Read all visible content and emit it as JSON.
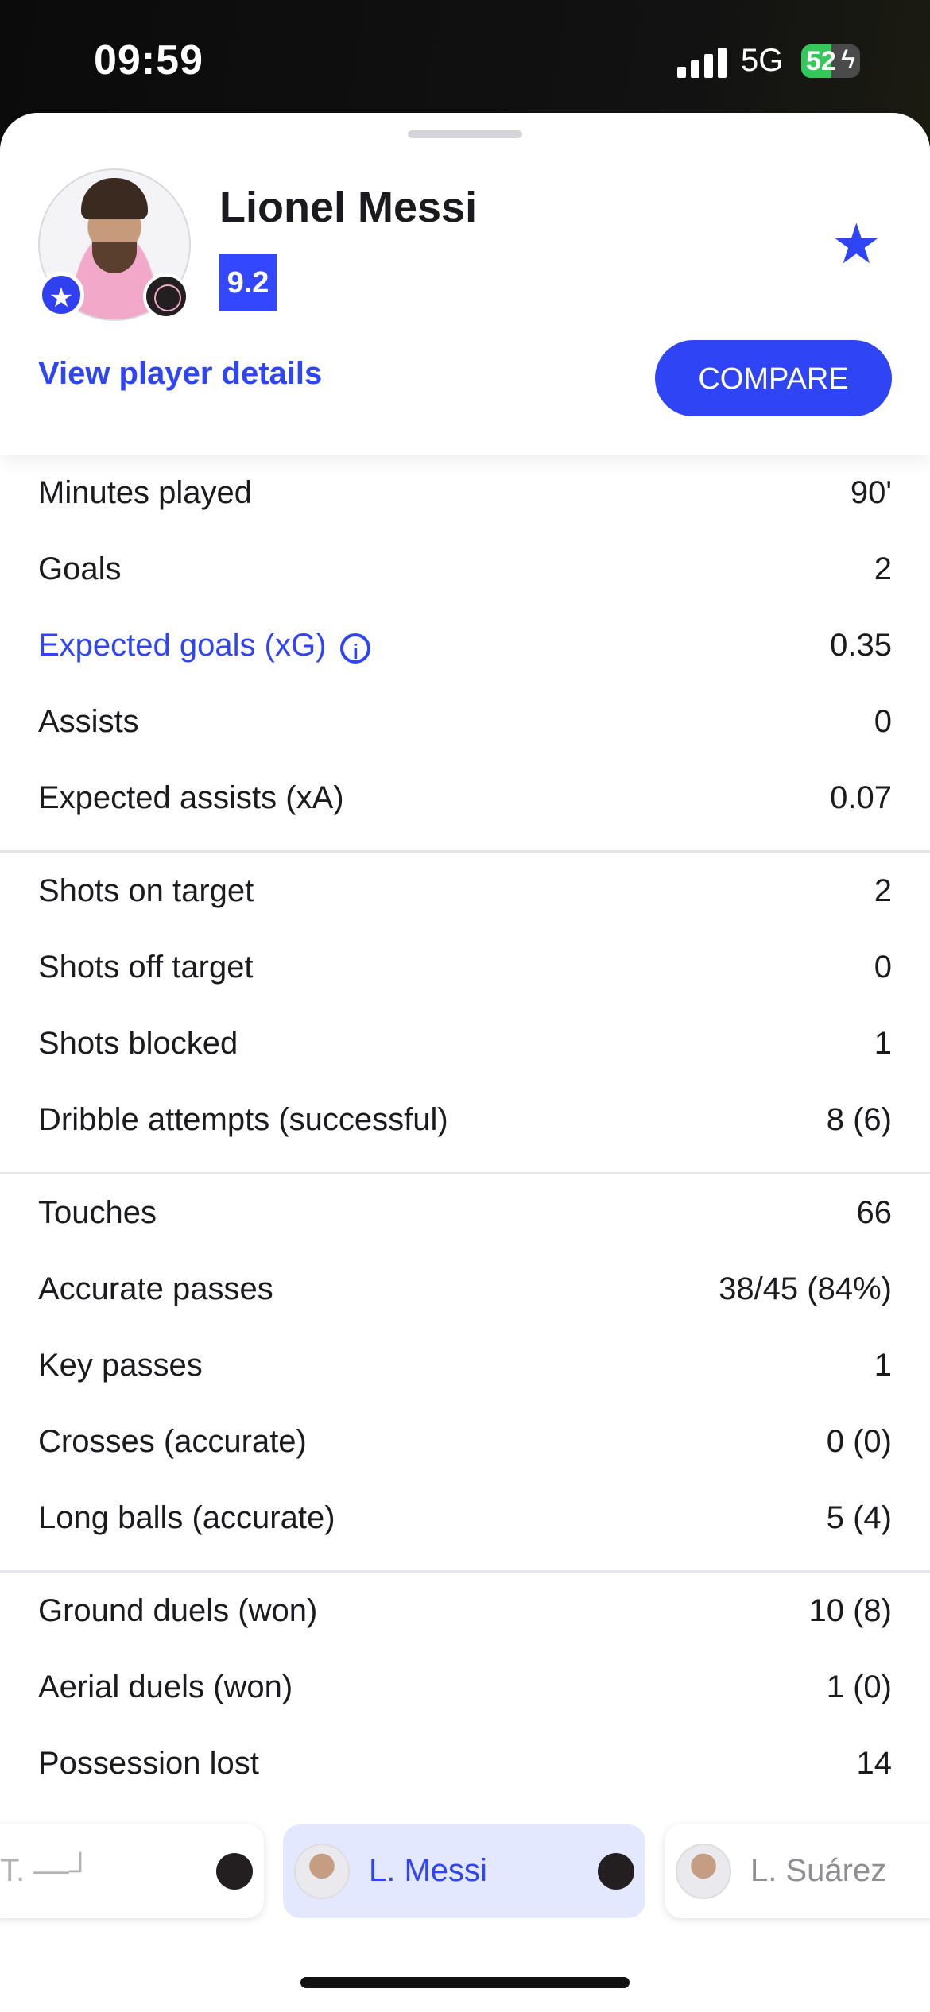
{
  "status_bar": {
    "time": "09:59",
    "network": "5G",
    "battery": "52",
    "battery_level": 0.52
  },
  "player": {
    "name": "Lionel Messi",
    "rating": "9.2",
    "view_details_label": "View player details",
    "compare_label": "COMPARE"
  },
  "stat_groups": [
    {
      "rows": [
        {
          "label": "Minutes played",
          "value": "90'"
        },
        {
          "label": "Goals",
          "value": "2"
        },
        {
          "label": "Expected goals (xG)",
          "value": "0.35"
        },
        {
          "label": "Assists",
          "value": "0"
        },
        {
          "label": "Expected assists (xA)",
          "value": "0.07"
        }
      ]
    },
    {
      "rows": [
        {
          "label": "Shots on target",
          "value": "2"
        },
        {
          "label": "Shots off target",
          "value": "0"
        },
        {
          "label": "Shots blocked",
          "value": "1"
        },
        {
          "label": "Dribble attempts (successful)",
          "value": "8 (6)"
        }
      ]
    },
    {
      "rows": [
        {
          "label": "Touches",
          "value": "66"
        },
        {
          "label": "Accurate passes",
          "value": "38/45 (84%)"
        },
        {
          "label": "Key passes",
          "value": "1"
        },
        {
          "label": "Crosses (accurate)",
          "value": "0 (0)"
        },
        {
          "label": "Long balls (accurate)",
          "value": "5 (4)"
        }
      ]
    },
    {
      "rows": [
        {
          "label": "Ground duels (won)",
          "value": "10 (8)"
        },
        {
          "label": "Aerial duels (won)",
          "value": "1 (0)"
        },
        {
          "label": "Possession lost",
          "value": "14"
        }
      ]
    }
  ],
  "switcher": {
    "left_name": "T. ––┘",
    "active_name": "L. Messi",
    "right_name": "L. Suárez"
  },
  "colors": {
    "accent": "#2f45f5",
    "rating_bg": "#3347ff",
    "active_chip": "#e4e8ff"
  },
  "icons": [
    "star-icon",
    "info-icon",
    "club-crest-icon"
  ]
}
